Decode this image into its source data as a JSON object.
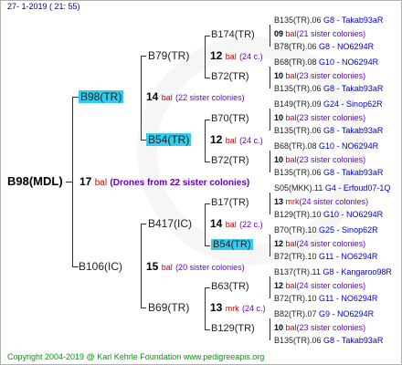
{
  "header": "27-  1-2019 ( 21: 55)",
  "footer": "Copyright 2004-2019 @ Karl Kehrle Foundation     www.pedigreeapis.org",
  "root": {
    "name": "B98(MDL)",
    "count": "17",
    "unit": "bal",
    "note": "(Drones from 22 sister colonies)"
  },
  "gen1": [
    {
      "name": "B98(TR)",
      "count": "14",
      "unit": "bal",
      "note": "(22 sister colonies)"
    },
    {
      "name": "B106(IC)",
      "count": "15",
      "unit": "bal",
      "note": "(20 sister colonies)"
    }
  ],
  "gen2": [
    {
      "name": "B79(TR)",
      "count": "12",
      "unit": "bal",
      "note": "(24 c.)"
    },
    {
      "name": "B54(TR)",
      "count": "12",
      "unit": "bal",
      "note": "(24 c.)"
    },
    {
      "name": "B417(IC)",
      "count": "14",
      "unit": "bal",
      "note": "(22 c.)"
    },
    {
      "name": "B69(TR)",
      "count": "13",
      "unit": "mrk",
      "note": "(24 c.)"
    }
  ],
  "gen3": [
    {
      "name": "B174(TR)",
      "count": "09",
      "unit": "bal",
      "note": "(21 sister colonies)"
    },
    {
      "name": "B72(TR)",
      "count": "10",
      "unit": "bal",
      "note": "(23 sister colonies)"
    },
    {
      "name": "B70(TR)",
      "count": "10",
      "unit": "bal",
      "note": "(23 sister colonies)"
    },
    {
      "name": "B72(TR)",
      "count": "10",
      "unit": "bal",
      "note": "(23 sister colonies)"
    },
    {
      "name": "B17(TR)",
      "count": "13",
      "unit": "mrk",
      "note": "(24 sister colonies)"
    },
    {
      "name": "B54(TR)",
      "count": "12",
      "unit": "bal",
      "note": "(24 sister colonies)"
    },
    {
      "name": "B63(TR)",
      "count": "12",
      "unit": "bal",
      "note": "(24 sister colonies)"
    },
    {
      "name": "B129(TR)",
      "count": "10",
      "unit": "bal",
      "note": "(23 sister colonies)"
    }
  ],
  "gen4": [
    {
      "name": "B135(TR).06",
      "code": "G8 - Takab93aR"
    },
    {
      "name": "B78(TR).06",
      "code": "G8 - NO6294R"
    },
    {
      "name": "B68(TR).08",
      "code": "G10 - NO6294R"
    },
    {
      "name": "B135(TR).06",
      "code": "G8 - Takab93aR"
    },
    {
      "name": "B149(TR).09",
      "code": "G24 - Sinop62R"
    },
    {
      "name": "B135(TR).06",
      "code": "G8 - Takab93aR"
    },
    {
      "name": "B68(TR).08",
      "code": "G10 - NO6294R"
    },
    {
      "name": "B135(TR).06",
      "code": "G8 - Takab93aR"
    },
    {
      "name": "S05(MKK).11",
      "code": "G4 - Erfoud07-1Q"
    },
    {
      "name": "B129(TR).10",
      "code": "G10 - NO6294R"
    },
    {
      "name": "B70(TR).10",
      "code": "G25 - Sinop62R"
    },
    {
      "name": "B72(TR).10",
      "code": "G11 - NO6294R"
    },
    {
      "name": "B137(TR).11",
      "code": "G8 - Kangaroo98R"
    },
    {
      "name": "B72(TR).10",
      "code": "G11 - NO6294R"
    },
    {
      "name": "B82(TR).07",
      "code": "G9 - NO6294R"
    },
    {
      "name": "B135(TR).06",
      "code": "G8 - Takab93aR"
    }
  ]
}
